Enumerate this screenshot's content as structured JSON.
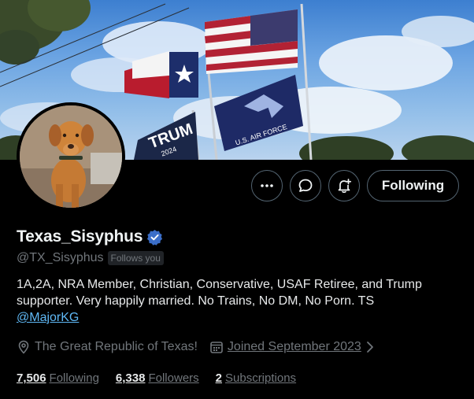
{
  "profile": {
    "display_name": "Texas_Sisyphus",
    "handle": "@TX_Sisyphus",
    "follows_you_badge": "Follows you",
    "verified_badge_icon": "verified-check-icon",
    "verified_color": "#3b6ec8"
  },
  "banner": {
    "description_icons": [
      "us-flag",
      "texas-flag",
      "air-force-flag",
      "trump-flag"
    ],
    "flag_texts": {
      "air_force": "U.S. AIR FORCE",
      "trump": "TRUM",
      "trump_year": "2024"
    }
  },
  "actions": {
    "more_icon": "more-dots-icon",
    "message_icon": "message-bubble-icon",
    "notify_icon": "bell-plus-icon",
    "following_label": "Following"
  },
  "bio": {
    "line1": "1A,2A, NRA Member, Christian, Conservative, USAF Retiree, and Trump",
    "line2": "supporter. Very happily married. No Trains, No DM, No Porn. TS",
    "mention": "@MajorKG"
  },
  "meta": {
    "location_icon": "location-pin-icon",
    "location": "The Great Republic of Texas!",
    "calendar_icon": "calendar-icon",
    "joined": "Joined September 2023",
    "chevron_icon": "chevron-right-icon"
  },
  "stats": {
    "following_count": "7,506",
    "following_label": "Following",
    "followers_count": "6,338",
    "followers_label": "Followers",
    "subscriptions_count": "2",
    "subscriptions_label": "Subscriptions"
  },
  "colors": {
    "background": "#000000",
    "primary_text": "#e7e9ea",
    "secondary_text": "#71767b",
    "link": "#5fb8f5",
    "button_border": "#536471"
  }
}
